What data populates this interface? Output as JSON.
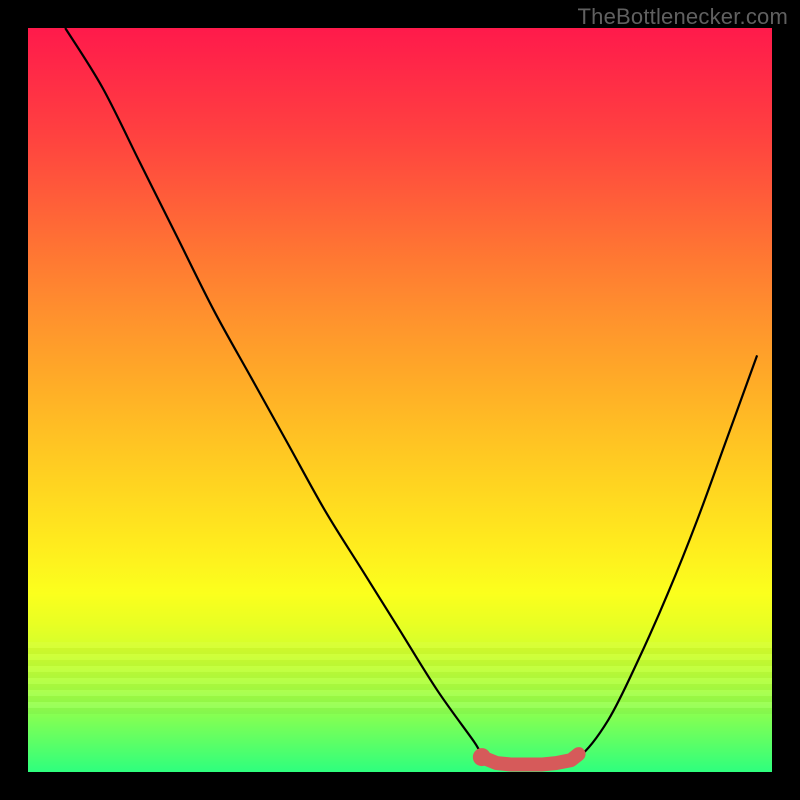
{
  "watermark": "TheBottleneсker.com",
  "colors": {
    "background": "#000000",
    "curve": "#000000",
    "marker": "#d65a5a",
    "watermark": "#606060"
  },
  "chart_data": {
    "type": "line",
    "title": "",
    "xlabel": "",
    "ylabel": "",
    "xlim": [
      0,
      100
    ],
    "ylim": [
      0,
      100
    ],
    "series": [
      {
        "name": "bottleneck-curve",
        "x": [
          5,
          10,
          15,
          20,
          25,
          30,
          35,
          40,
          45,
          50,
          55,
          60,
          62,
          66,
          70,
          74,
          78,
          82,
          86,
          90,
          94,
          98
        ],
        "values": [
          100,
          92,
          82,
          72,
          62,
          53,
          44,
          35,
          27,
          19,
          11,
          4,
          1,
          1,
          1,
          2,
          7,
          15,
          24,
          34,
          45,
          56
        ]
      }
    ],
    "markers": {
      "name": "optimal-range",
      "x": [
        61,
        63,
        65,
        67,
        69,
        71,
        73,
        74
      ],
      "values": [
        2,
        1.2,
        1,
        1,
        1,
        1.2,
        1.6,
        2.4
      ]
    },
    "gradient_stops": [
      {
        "pos": 0.0,
        "color": "#ff1a4b"
      },
      {
        "pos": 0.5,
        "color": "#ffc822"
      },
      {
        "pos": 0.8,
        "color": "#eaff22"
      },
      {
        "pos": 1.0,
        "color": "#2eff7e"
      }
    ]
  }
}
